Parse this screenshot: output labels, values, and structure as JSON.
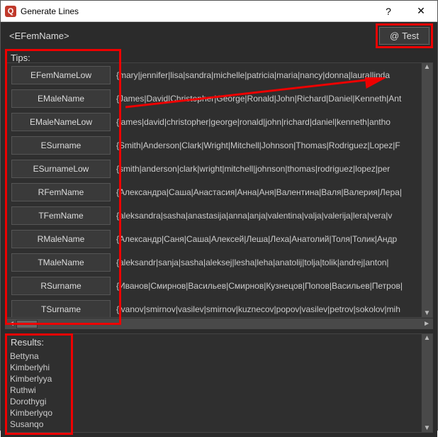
{
  "window": {
    "title": "Generate Lines",
    "app_icon_letter": "Q"
  },
  "pattern_input": "<EFemName>",
  "test_button_label": "Test",
  "tips_label": "Tips:",
  "tips": [
    {
      "name": "EFemNameLow",
      "value": "{mary|jennifer|lisa|sandra|michelle|patricia|maria|nancy|donna|laura|linda"
    },
    {
      "name": "EMaleName",
      "value": "{James|David|Christopher|George|Ronald|John|Richard|Daniel|Kenneth|Ant"
    },
    {
      "name": "EMaleNameLow",
      "value": "{james|david|christopher|george|ronald|john|richard|daniel|kenneth|antho"
    },
    {
      "name": "ESurname",
      "value": "{Smith|Anderson|Clark|Wright|Mitchell|Johnson|Thomas|Rodriguez|Lopez|F"
    },
    {
      "name": "ESurnameLow",
      "value": "{smith|anderson|clark|wright|mitchell|johnson|thomas|rodriguez|lopez|per"
    },
    {
      "name": "RFemName",
      "value": "{Александра|Саша|Анастасия|Анна|Аня|Валентина|Валя|Валерия|Лера|"
    },
    {
      "name": "TFemName",
      "value": "{aleksandra|sasha|anastasija|anna|anja|valentina|valja|valerija|lera|vera|v"
    },
    {
      "name": "RMaleName",
      "value": "{Александр|Саня|Саша|Алексей|Леша|Леха|Анатолий|Толя|Толик|Андр"
    },
    {
      "name": "TMaleName",
      "value": "{aleksandr|sanja|sasha|aleksej|lesha|leha|anatolij|tolja|tolik|andrej|anton|"
    },
    {
      "name": "RSurname",
      "value": "{Иванов|Смирнов|Васильев|Смирнов|Кузнецов|Попов|Васильев|Петров|"
    },
    {
      "name": "TSurname",
      "value": "{ivanov|smirnov|vasilev|smirnov|kuznecov|popov|vasilev|petrov|sokolov|mih"
    }
  ],
  "results_label": "Results:",
  "results": [
    "Bettyna",
    "Kimberlyhi",
    "Kimberlyya",
    "Ruthwi",
    "Dorothygi",
    "Kimberlyqo",
    "Susanqo"
  ]
}
